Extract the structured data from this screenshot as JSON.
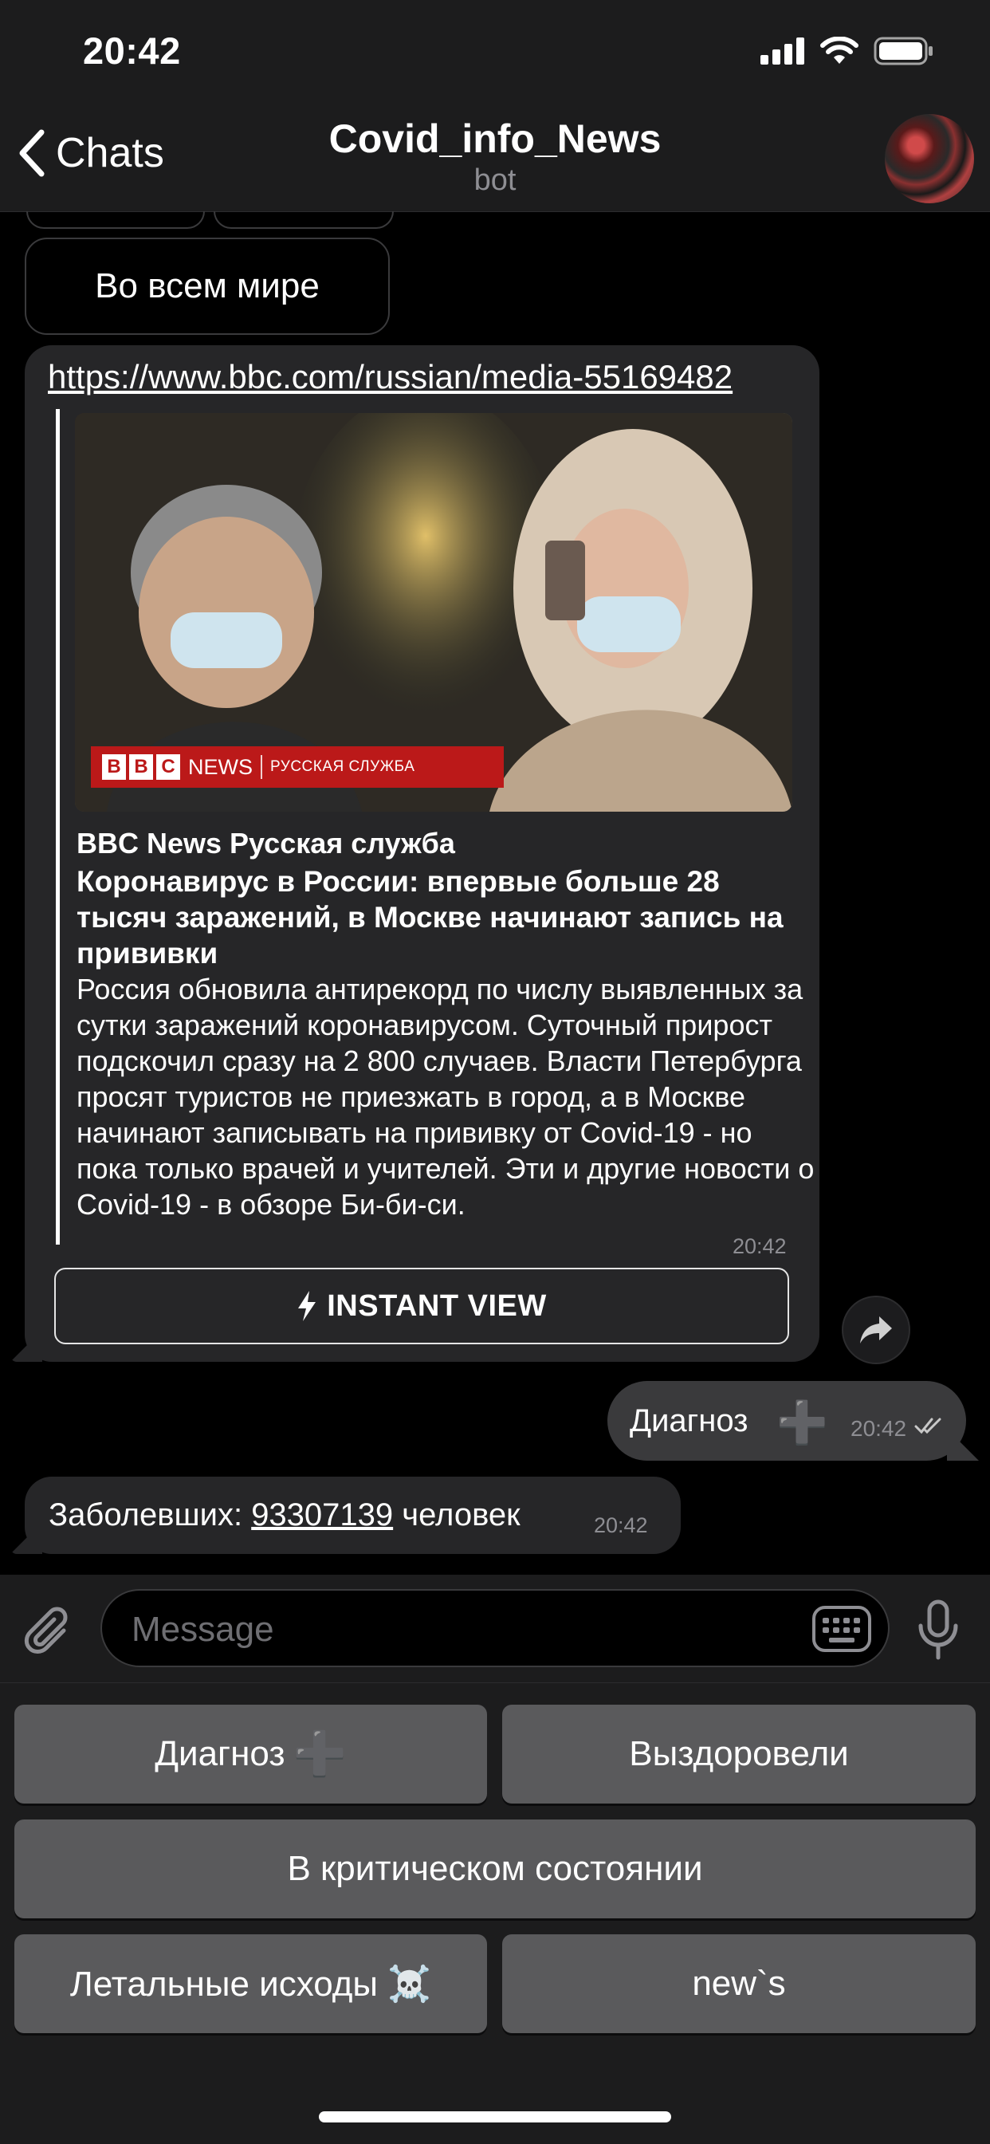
{
  "status": {
    "time": "20:42"
  },
  "nav": {
    "back_label": "Chats",
    "title": "Covid_info_News",
    "subtitle": "bot"
  },
  "chat": {
    "inline_button": "Во всем мире",
    "message1": {
      "link": "https://www.bbc.com/russian/media-55169482",
      "preview": {
        "badge_letters": [
          "B",
          "B",
          "C"
        ],
        "badge_news": "NEWS",
        "badge_service": "РУССКАЯ СЛУЖБА",
        "site_name": "BBC News Русская служба",
        "headline": "Коронавирус в России: впервые больше 28 тысяч заражений, в Москве начинают запись на прививки",
        "description": "Россия обновила антирекорд по числу выявленных за сутки заражений коронавирусом. Суточный прирост подскочил сразу на 2 800 случаев. Власти Петербурга просят туристов не приезжать в город, а в Москве начинают записывать на прививку от Covid-19 - но пока только врачей и учителей. Эти и другие новости о Covid-19 - в обзоре Би-би-си."
      },
      "time": "20:42",
      "instant_view_label": "INSTANT VIEW"
    },
    "message2": {
      "text": "Диагноз",
      "plus": "➕",
      "time": "20:42"
    },
    "message3": {
      "prefix": "Заболевших: ",
      "number": "93307139",
      "suffix": " человек",
      "time": "20:42"
    }
  },
  "composer": {
    "placeholder": "Message"
  },
  "keyboard": {
    "diagnosis": "Диагноз",
    "plus": "➕",
    "recovered": "Выздоровели",
    "critical": "В критическом состоянии",
    "deaths": "Летальные исходы ☠️",
    "news": "new`s"
  },
  "colors": {
    "accent_bar": "#bb1919",
    "bubble": "#262628",
    "outgoing_bubble": "#3a3a3c",
    "keyboard_button": "#5a5a5c"
  }
}
